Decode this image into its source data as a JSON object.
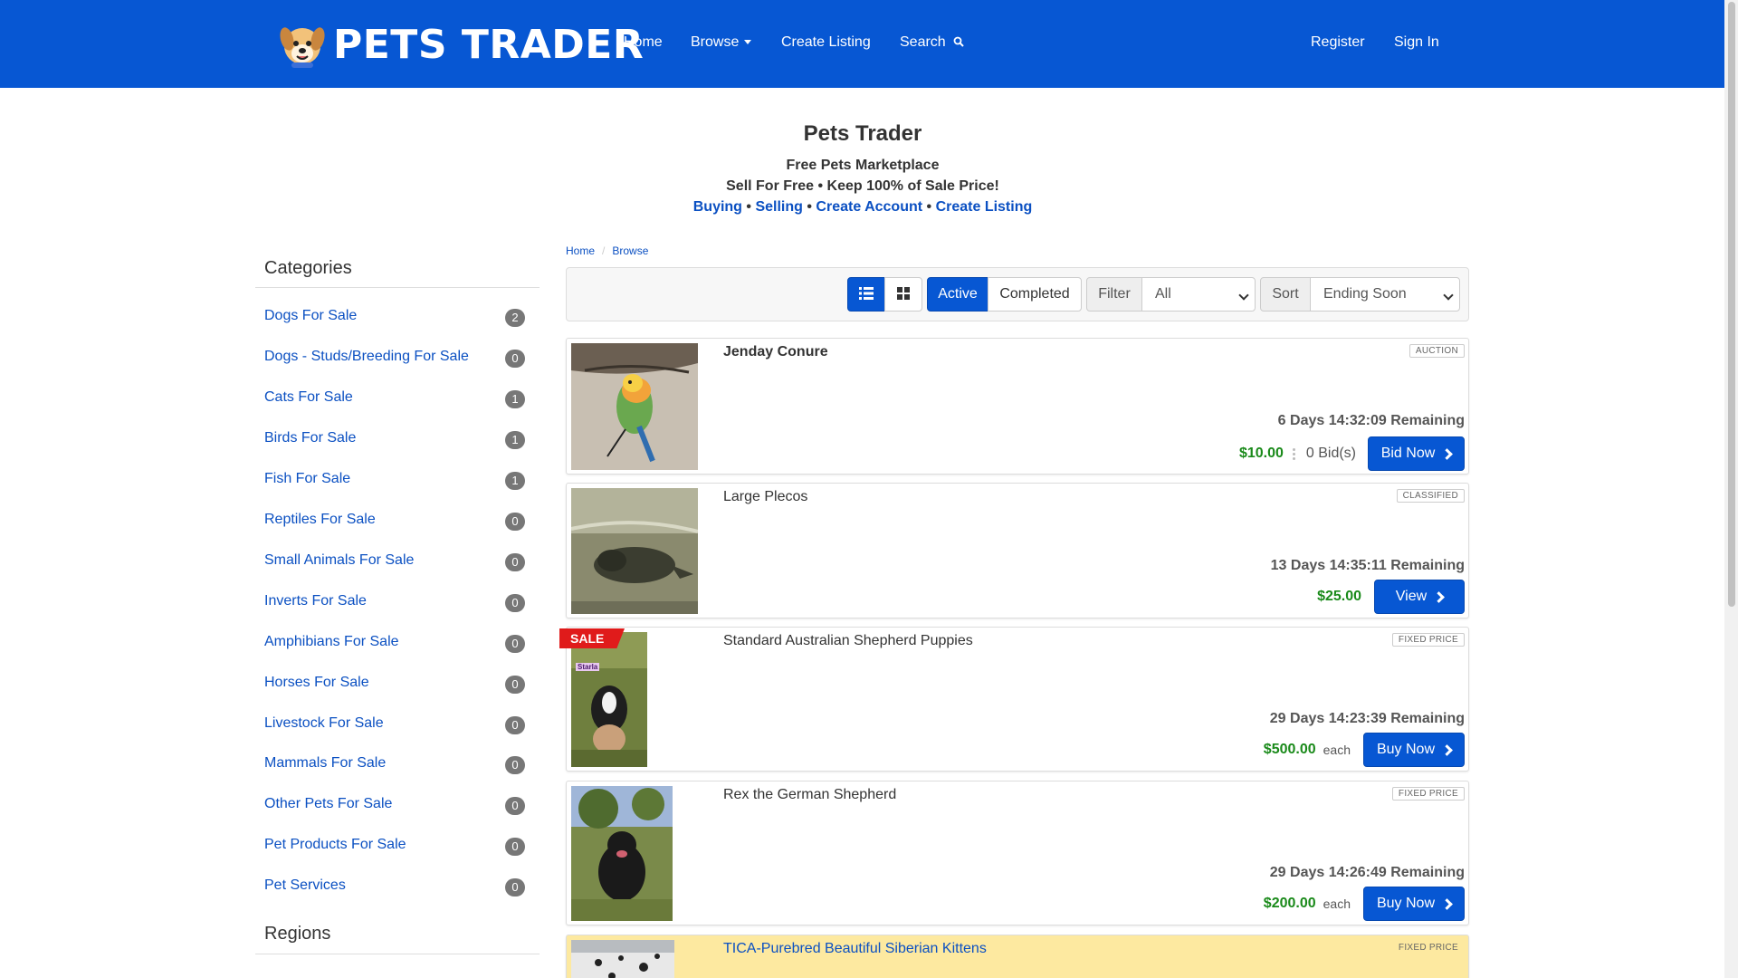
{
  "nav": {
    "logo_text": "PETS TRADER",
    "home": "Home",
    "browse": "Browse",
    "create_listing": "Create Listing",
    "search": "Search",
    "register": "Register",
    "sign_in": "Sign In"
  },
  "hero": {
    "title": "Pets Trader",
    "line1": "Free Pets Marketplace",
    "line2": "Sell For Free • Keep 100% of Sale Price!",
    "links": [
      "Buying",
      "Selling",
      "Create Account",
      "Create Listing"
    ],
    "separator": " • "
  },
  "sidebar": {
    "categories_heading": "Categories",
    "categories": [
      {
        "label": "Dogs For Sale",
        "count": "2"
      },
      {
        "label": "Dogs - Studs/Breeding For Sale",
        "count": "0"
      },
      {
        "label": "Cats For Sale",
        "count": "1"
      },
      {
        "label": "Birds For Sale",
        "count": "1"
      },
      {
        "label": "Fish For Sale",
        "count": "1"
      },
      {
        "label": "Reptiles For Sale",
        "count": "0"
      },
      {
        "label": "Small Animals For Sale",
        "count": "0"
      },
      {
        "label": "Inverts For Sale",
        "count": "0"
      },
      {
        "label": "Amphibians For Sale",
        "count": "0"
      },
      {
        "label": "Horses For Sale",
        "count": "0"
      },
      {
        "label": "Livestock For Sale",
        "count": "0"
      },
      {
        "label": "Mammals For Sale",
        "count": "0"
      },
      {
        "label": "Other Pets For Sale",
        "count": "0"
      },
      {
        "label": "Pet Products For Sale",
        "count": "0"
      },
      {
        "label": "Pet Services",
        "count": "0"
      }
    ],
    "regions_heading": "Regions"
  },
  "breadcrumb": {
    "home": "Home",
    "browse": "Browse"
  },
  "toolbar": {
    "view_list_icon": "list-icon",
    "view_grid_icon": "grid-icon",
    "active": "Active",
    "completed": "Completed",
    "filter_label": "Filter",
    "filter_value": "All",
    "sort_label": "Sort",
    "sort_value": "Ending Soon"
  },
  "listings": [
    {
      "title": "Jenday Conure",
      "type": "AUCTION",
      "remaining": "6 Days 14:32:09 Remaining",
      "price": "$10.00",
      "bids": "0 Bid(s)",
      "action": "Bid Now"
    },
    {
      "title": "Large Plecos",
      "type": "CLASSIFIED",
      "remaining": "13 Days 14:35:11 Remaining",
      "price": "$25.00",
      "action": "View"
    },
    {
      "title": "Standard Australian Shepherd Puppies",
      "type": "FIXED PRICE",
      "remaining": "29 Days 14:23:39 Remaining",
      "price": "$500.00",
      "unit": "each",
      "action": "Buy Now",
      "ribbon": "SALE",
      "photo_caption": "Starla"
    },
    {
      "title": "Rex the German Shepherd",
      "type": "FIXED PRICE",
      "remaining": "29 Days 14:26:49 Remaining",
      "price": "$200.00",
      "unit": "each",
      "action": "Buy Now"
    },
    {
      "title": "TICA-Purebred Beautiful Siberian Kittens",
      "type": "FIXED PRICE"
    }
  ],
  "colors": {
    "brand": "#0757d3",
    "link": "#0b50c2",
    "price": "#1a8a1a",
    "highlight": "#fde9a0",
    "sale": "#e01b1b"
  }
}
